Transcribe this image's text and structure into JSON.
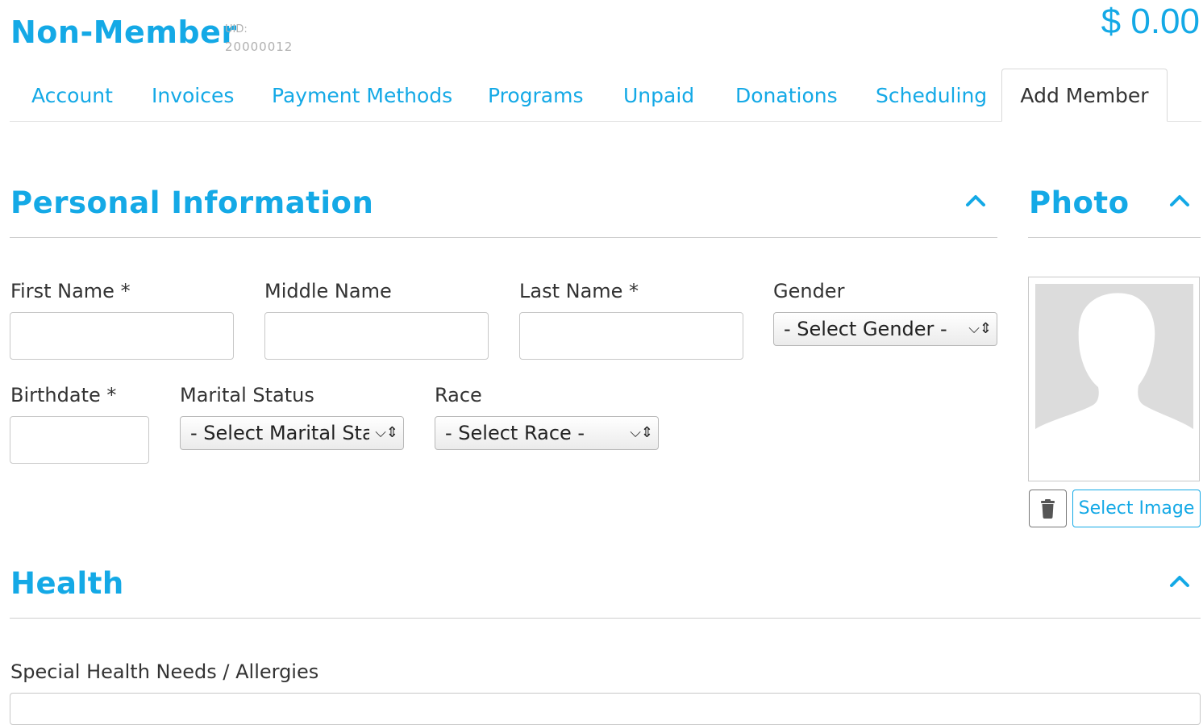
{
  "header": {
    "member_type": "Non-Member",
    "uid_label": "UID:",
    "uid_value": "20000012",
    "balance": "$ 0.00"
  },
  "tabs": [
    {
      "label": "Account"
    },
    {
      "label": "Invoices"
    },
    {
      "label": "Payment Methods"
    },
    {
      "label": "Programs"
    },
    {
      "label": "Unpaid"
    },
    {
      "label": "Donations"
    },
    {
      "label": "Scheduling"
    },
    {
      "label": "Add Member",
      "active": true
    }
  ],
  "personal": {
    "title": "Personal Information",
    "first_name_label": "First Name *",
    "first_name_value": "",
    "middle_name_label": "Middle Name",
    "middle_name_value": "",
    "last_name_label": "Last Name *",
    "last_name_value": "",
    "gender_label": "Gender",
    "gender_selected": "- Select Gender -",
    "birthdate_label": "Birthdate *",
    "birthdate_value": "",
    "marital_label": "Marital Status",
    "marital_selected": "- Select Marital Status -",
    "race_label": "Race",
    "race_selected": "- Select Race -"
  },
  "photo": {
    "title": "Photo",
    "select_image_label": "Select Image",
    "delete_icon": "trash-icon",
    "placeholder_icon": "avatar-silhouette-icon"
  },
  "health": {
    "title": "Health",
    "special_needs_label": "Special Health Needs / Allergies",
    "special_needs_value": ""
  },
  "colors": {
    "accent": "#14a9e6",
    "text": "#333333",
    "muted": "#b0b0b0",
    "placeholder_gray": "#dcdcdc"
  }
}
